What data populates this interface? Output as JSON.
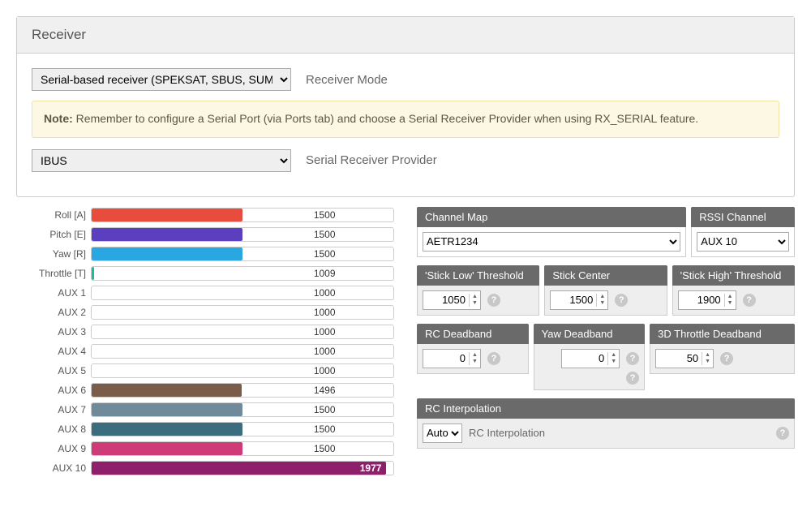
{
  "panel": {
    "title": "Receiver"
  },
  "receiver_mode": {
    "selected": "Serial-based receiver (SPEKSAT, SBUS, SUMD)",
    "label": "Receiver Mode"
  },
  "note": {
    "prefix": "Note:",
    "text": " Remember to configure a Serial Port (via Ports tab) and choose a Serial Receiver Provider when using RX_SERIAL feature."
  },
  "serial_provider": {
    "selected": "IBUS",
    "label": "Serial Receiver Provider"
  },
  "channels": [
    {
      "name": "Roll [A]",
      "value": 1500,
      "color": "#e74c3c"
    },
    {
      "name": "Pitch [E]",
      "value": 1500,
      "color": "#5b3fbf"
    },
    {
      "name": "Yaw [R]",
      "value": 1500,
      "color": "#2aa7e0"
    },
    {
      "name": "Throttle [T]",
      "value": 1009,
      "color": "#1abc9c"
    },
    {
      "name": "AUX 1",
      "value": 1000,
      "color": "#118f74"
    },
    {
      "name": "AUX 2",
      "value": 1000,
      "color": "#4fa83d"
    },
    {
      "name": "AUX 3",
      "value": 1000,
      "color": "#c4c527"
    },
    {
      "name": "AUX 4",
      "value": 1000,
      "color": "#e2a21e"
    },
    {
      "name": "AUX 5",
      "value": 1000,
      "color": "#e0611b"
    },
    {
      "name": "AUX 6",
      "value": 1496,
      "color": "#7b5b4a"
    },
    {
      "name": "AUX 7",
      "value": 1500,
      "color": "#6f8a9a"
    },
    {
      "name": "AUX 8",
      "value": 1500,
      "color": "#3b6d7f"
    },
    {
      "name": "AUX 9",
      "value": 1500,
      "color": "#cf3b77"
    },
    {
      "name": "AUX 10",
      "value": 1977,
      "color": "#8e1f6a",
      "bold": true
    }
  ],
  "range": {
    "min": 1000,
    "max": 2000
  },
  "channel_map": {
    "header": "Channel Map",
    "selected": "AETR1234"
  },
  "rssi": {
    "header": "RSSI Channel",
    "selected": "AUX 10"
  },
  "thresholds": {
    "low": {
      "header": "'Stick Low' Threshold",
      "value": 1050
    },
    "center": {
      "header": "Stick Center",
      "value": 1500
    },
    "high": {
      "header": "'Stick High' Threshold",
      "value": 1900
    }
  },
  "deadbands": {
    "rc": {
      "header": "RC Deadband",
      "value": 0
    },
    "yaw": {
      "header": "Yaw Deadband",
      "value": 0
    },
    "throttle3d": {
      "header": "3D Throttle Deadband",
      "value": 50
    }
  },
  "interpolation": {
    "header": "RC Interpolation",
    "selected": "Auto",
    "label": "RC Interpolation"
  }
}
